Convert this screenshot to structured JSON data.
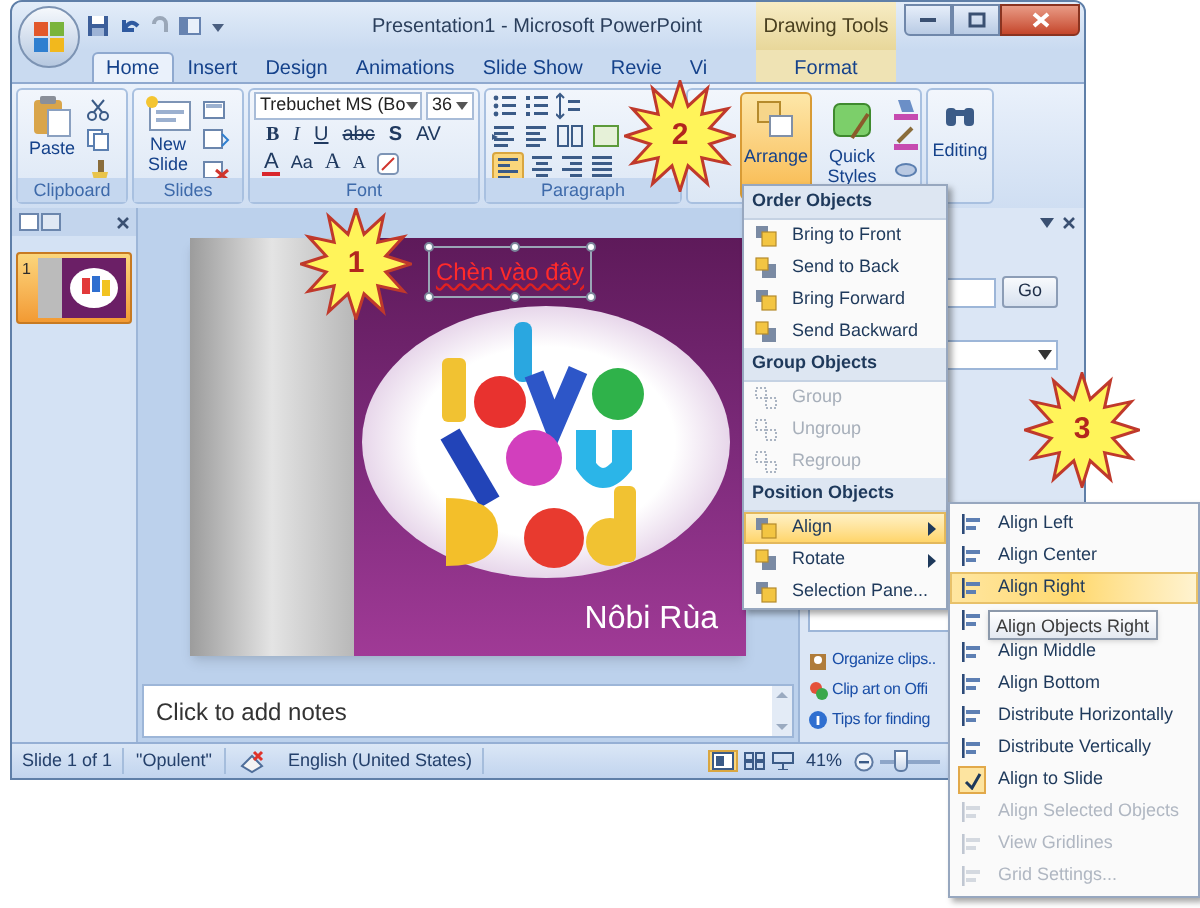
{
  "window": {
    "title": "Presentation1 - Microsoft PowerPoint",
    "contextual_group": "Drawing Tools"
  },
  "tabs": [
    {
      "label": "Home",
      "selected": true,
      "kind": "regular"
    },
    {
      "label": "Insert",
      "selected": false,
      "kind": "regular"
    },
    {
      "label": "Design",
      "selected": false,
      "kind": "regular"
    },
    {
      "label": "Animations",
      "selected": false,
      "kind": "regular"
    },
    {
      "label": "Slide Show",
      "selected": false,
      "kind": "regular"
    },
    {
      "label": "Revie",
      "selected": false,
      "kind": "regular"
    },
    {
      "label": "Vi",
      "selected": false,
      "kind": "regular"
    },
    {
      "label": "Format",
      "selected": false,
      "kind": "contextual"
    }
  ],
  "ribbon": {
    "clipboard": {
      "label": "Clipboard",
      "paste": "Paste"
    },
    "slides": {
      "label": "Slides",
      "new_slide": "New Slide"
    },
    "font": {
      "label": "Font",
      "font_name": "Trebuchet MS (Bo",
      "font_size": "36",
      "style_buttons": [
        "B",
        "I",
        "U",
        "abc",
        "S",
        "AV"
      ],
      "color_buttons": [
        "A",
        "Aa",
        "A",
        "A"
      ]
    },
    "paragraph": {
      "label": "Paragraph"
    },
    "drawing": {
      "buttons": [
        {
          "label": "Arrange",
          "selected": true
        },
        {
          "label": "Quick Styles",
          "selected": false
        }
      ]
    },
    "editing": {
      "label": "Editing"
    }
  },
  "slide_panel": {
    "slides": [
      {
        "number": "1",
        "selected": true
      }
    ]
  },
  "slide": {
    "title": "Chèn vào đây",
    "title_selected": true,
    "caption": "Nôbi Rùa"
  },
  "notes": {
    "placeholder": "Click to add notes"
  },
  "task_pane": {
    "search_button": "Go",
    "links": [
      "Organize clips..",
      "Clip art on Offi",
      "Tips for finding"
    ]
  },
  "arrange_menu": {
    "sections": [
      {
        "heading": "Order Objects",
        "items": [
          {
            "label": "Bring to Front",
            "selected": false,
            "disabled": false,
            "submenu": false
          },
          {
            "label": "Send to Back",
            "selected": false,
            "disabled": false,
            "submenu": false
          },
          {
            "label": "Bring Forward",
            "selected": false,
            "disabled": false,
            "submenu": false
          },
          {
            "label": "Send Backward",
            "selected": false,
            "disabled": false,
            "submenu": false
          }
        ]
      },
      {
        "heading": "Group Objects",
        "items": [
          {
            "label": "Group",
            "selected": false,
            "disabled": true,
            "submenu": false
          },
          {
            "label": "Ungroup",
            "selected": false,
            "disabled": true,
            "submenu": false
          },
          {
            "label": "Regroup",
            "selected": false,
            "disabled": true,
            "submenu": false
          }
        ]
      },
      {
        "heading": "Position Objects",
        "items": [
          {
            "label": "Align",
            "selected": true,
            "disabled": false,
            "submenu": true
          },
          {
            "label": "Rotate",
            "selected": false,
            "disabled": false,
            "submenu": true
          },
          {
            "label": "Selection Pane...",
            "selected": false,
            "disabled": false,
            "submenu": false
          }
        ]
      }
    ]
  },
  "align_submenu": {
    "items": [
      {
        "label": "Align Left",
        "selected": false,
        "checked": false,
        "disabled": false
      },
      {
        "label": "Align Center",
        "selected": false,
        "checked": false,
        "disabled": false
      },
      {
        "label": "Align Right",
        "selected": true,
        "checked": false,
        "disabled": false
      },
      {
        "selected": false,
        "checked": false,
        "disabled": false
      },
      {
        "label": "Align Middle",
        "selected": false,
        "checked": false,
        "disabled": false
      },
      {
        "label": "Align Bottom",
        "selected": false,
        "checked": false,
        "disabled": false
      },
      {
        "label": "Distribute Horizontally",
        "selected": false,
        "checked": false,
        "disabled": false
      },
      {
        "label": "Distribute Vertically",
        "selected": false,
        "checked": false,
        "disabled": false
      },
      {
        "label": "Align to Slide",
        "selected": false,
        "checked": true,
        "disabled": false
      },
      {
        "label": "Align Selected Objects",
        "selected": false,
        "checked": false,
        "disabled": true
      },
      {
        "label": "View Gridlines",
        "selected": false,
        "checked": false,
        "disabled": true
      },
      {
        "label": "Grid Settings...",
        "selected": false,
        "checked": false,
        "disabled": true
      }
    ]
  },
  "tooltip": "Align Objects Right",
  "status_bar": {
    "slide": "Slide 1 of 1",
    "theme": "\"Opulent\"",
    "language": "English (United States)",
    "zoom": "41%",
    "zoom_slider": {
      "level": 0.3
    }
  },
  "callouts": [
    {
      "number": "1"
    },
    {
      "number": "2"
    },
    {
      "number": "3"
    }
  ]
}
